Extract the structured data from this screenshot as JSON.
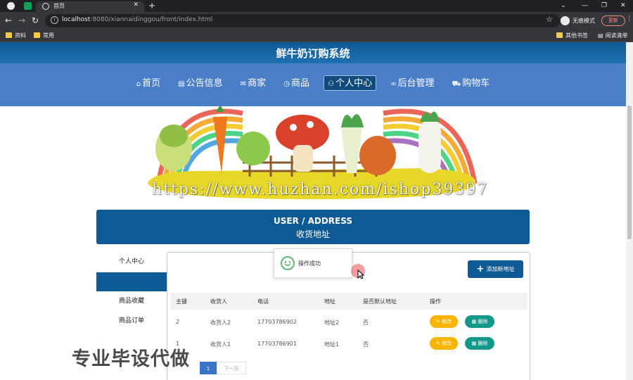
{
  "browser": {
    "tab_title": "首页",
    "url_host": "localhost",
    "url_rest": ":8080/xiannaidinggou/front/index.html",
    "incognito_label": "无痕模式",
    "update_label": "更新",
    "bookmarks": [
      "资料",
      "常用"
    ],
    "bookmarks_right": [
      "其他书签",
      "阅读清单"
    ]
  },
  "site": {
    "title": "鲜牛奶订购系统",
    "nav": [
      {
        "icon": "⌂",
        "label": "首页"
      },
      {
        "icon": "▤",
        "label": "公告信息"
      },
      {
        "icon": "✉",
        "label": "商家"
      },
      {
        "icon": "◷",
        "label": "商品"
      },
      {
        "icon": "⚇",
        "label": "个人中心"
      },
      {
        "icon": "∞",
        "label": "后台管理"
      },
      {
        "icon": "⛟",
        "label": "购物车"
      }
    ],
    "active_nav": "个人中心",
    "watermark": "https://www.huzhan.com/ishop39397"
  },
  "section": {
    "title_en": "USER / ADDRESS",
    "title_cn": "收货地址"
  },
  "sidebar": {
    "items": [
      "个人中心",
      "收货地址",
      "商品收藏",
      "商品订单"
    ],
    "active": "收货地址"
  },
  "content": {
    "add_button": "添加新地址",
    "columns": [
      "主键",
      "收货人",
      "电话",
      "地址",
      "是否默认地址",
      "操作"
    ],
    "rows": [
      {
        "id": "2",
        "name": "收货人2",
        "phone": "17703786902",
        "address": "地址2",
        "default": "否"
      },
      {
        "id": "1",
        "name": "收货人1",
        "phone": "17703786901",
        "address": "地址1",
        "default": "否"
      }
    ],
    "edit_label": "修改",
    "delete_label": "删除",
    "pagination": {
      "current": "1",
      "next_label": "下一页"
    }
  },
  "toast": {
    "message": "操作成功"
  },
  "overlay_text": "专业毕设代做"
}
